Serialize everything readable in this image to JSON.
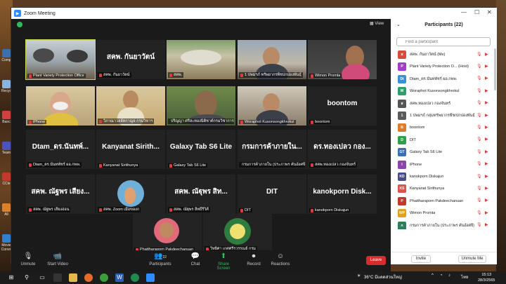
{
  "window": {
    "title": "Zoom Meeting"
  },
  "desktop_icons": [
    "Comp",
    "Recyc",
    "Banc",
    "Team",
    "CCle",
    "All",
    "Movie Conve"
  ],
  "meeting": {
    "view_label": "View",
    "tiles": [
      {
        "caption": "Plant Variety Protection Office",
        "big": "",
        "speaking": true,
        "video": "room"
      },
      {
        "caption": "สคพ. กันยาวัตน์",
        "big": "สคพ. กันยาวัตน์",
        "speaking": false,
        "video": ""
      },
      {
        "caption": "สคพ.",
        "big": "",
        "speaking": false,
        "video": "office"
      },
      {
        "caption": "1 ปพมฯภ์ ทรัพยากรพืชปกปองพันธุ์",
        "big": "",
        "speaking": false,
        "video": "man"
      },
      {
        "caption": "Wimon Promta",
        "big": "",
        "speaking": false,
        "video": "woman"
      },
      {
        "caption": "iPhone",
        "big": "",
        "speaking": false,
        "video": "mask"
      },
      {
        "caption": "วิภาณาวลย์ทกาญจ กรมวิชาฯ",
        "big": "",
        "speaking": false,
        "video": "woman2"
      },
      {
        "caption": "ปริญญา ศรีสะทองนิติชาต์กรมวิชาการเกษตร",
        "big": "",
        "speaking": false,
        "video": "man2"
      },
      {
        "caption": "Woraphot Kusonsongkhrokul",
        "big": "",
        "speaking": false,
        "video": "man3"
      },
      {
        "caption": "boontom",
        "big": "boontom",
        "speaking": false,
        "video": ""
      },
      {
        "caption": "Dtam_ตร.นันทพัชร์ ผอ.กพพ.",
        "big": "Dtam_ดร.นันทพ์...",
        "speaking": false,
        "video": ""
      },
      {
        "caption": "Kanyanat Sirithunya",
        "big": "Kanyanat Sirith...",
        "speaking": false,
        "video": ""
      },
      {
        "caption": "Galaxy Tab S6 Lite",
        "big": "Galaxy Tab S6 Lite",
        "speaking": false,
        "video": ""
      },
      {
        "caption": "กรมการค้าภายใน (ประภาพร คันอังศจี)",
        "big": "กรมการค้าภายใน...",
        "speaking": false,
        "video": ""
      },
      {
        "caption": "สคพ.ทองเปลว กองจันทร์",
        "big": "ดร.ทองเปลว กอง...",
        "speaking": false,
        "video": ""
      },
      {
        "caption": "สคพ. ณัฐพร เสียงอ่อน",
        "big": "สคพ. ณัฐพร เสียง...",
        "speaking": false,
        "video": ""
      },
      {
        "caption": "สคพ. Zoom เมื่อของก",
        "big": "",
        "speaking": false,
        "video": "beach"
      },
      {
        "caption": "สคพ. ณัฐุพร สิทธิ์รีวิศ์",
        "big": "สคพ. ณัฐุพร สิท...",
        "speaking": false,
        "video": ""
      },
      {
        "caption": "DIT",
        "big": "DIT",
        "speaking": false,
        "video": ""
      },
      {
        "caption": "kanokporn Diskajun",
        "big": "kanokporn Disk...",
        "speaking": false,
        "video": ""
      },
      {
        "caption": "Phattharaporn Pakdeechanuan",
        "big": "",
        "speaking": false,
        "video": "woman3"
      },
      {
        "caption": "วิทยิศา เกศศรีรวรรณย์ กรม",
        "big": "",
        "speaking": false,
        "video": "logo"
      }
    ]
  },
  "toolbar": {
    "unmute": "Unmute",
    "start_video": "Start Video",
    "participants": "Participants",
    "participants_count": "22",
    "chat": "Chat",
    "share": "Share Screen",
    "record": "Record",
    "reactions": "Reactions",
    "leave": "Leave"
  },
  "panel": {
    "title": "Participants (22)",
    "search_placeholder": "Find a participant",
    "participants": [
      {
        "initials": "ส",
        "color": "#d94a3b",
        "name": "สคพ. กันยาวัตน์ (Me)"
      },
      {
        "initials": "P",
        "color": "#a33dcc",
        "name": "Plant Variety Protection O... (Host)"
      },
      {
        "initials": "Dt",
        "color": "#3a8fd6",
        "name": "Dtam_ตร.นันทพัชร์ ผอ.กพพ."
      },
      {
        "initials": "W",
        "color": "#2e9e6a",
        "name": "Woraphot Kusonsongkhrokul"
      },
      {
        "initials": "ส",
        "color": "#555555",
        "name": "สคพ.ทองเปลว กองจันทร์"
      },
      {
        "initials": "1",
        "color": "#5b5b5b",
        "name": "1 ปพมฯภ์ กลุ่มทรัพยากรพืช/ปกปองพันธุ์"
      },
      {
        "initials": "B",
        "color": "#e07b2a",
        "name": "boontom"
      },
      {
        "initials": "D",
        "color": "#2ea04a",
        "name": "DIT"
      },
      {
        "initials": "GT",
        "color": "#3b6fb6",
        "name": "Galaxy Tab S6 Lite"
      },
      {
        "initials": "I",
        "color": "#8e44ad",
        "name": "iPhone"
      },
      {
        "initials": "KD",
        "color": "#4a4a8a",
        "name": "kanokporn Diskajun"
      },
      {
        "initials": "KS",
        "color": "#d9534f",
        "name": "Kanyanat Sirithunya"
      },
      {
        "initials": "P",
        "color": "#c0392b",
        "name": "Phattharaporn Pakdeechanuan"
      },
      {
        "initials": "WP",
        "color": "#e0a020",
        "name": "Wimon Promta"
      },
      {
        "initials": "ก",
        "color": "#2e7d5b",
        "name": "กรมการค้าภายใน (ประภาพร คันอังศจี)"
      }
    ],
    "invite": "Invite",
    "unmute_me": "Unmute Me"
  },
  "taskbar": {
    "weather": "36°C  มีแดดส่วนใหญ่",
    "lang": "ไทย",
    "time": "15:13",
    "date": "28/3/2565"
  }
}
